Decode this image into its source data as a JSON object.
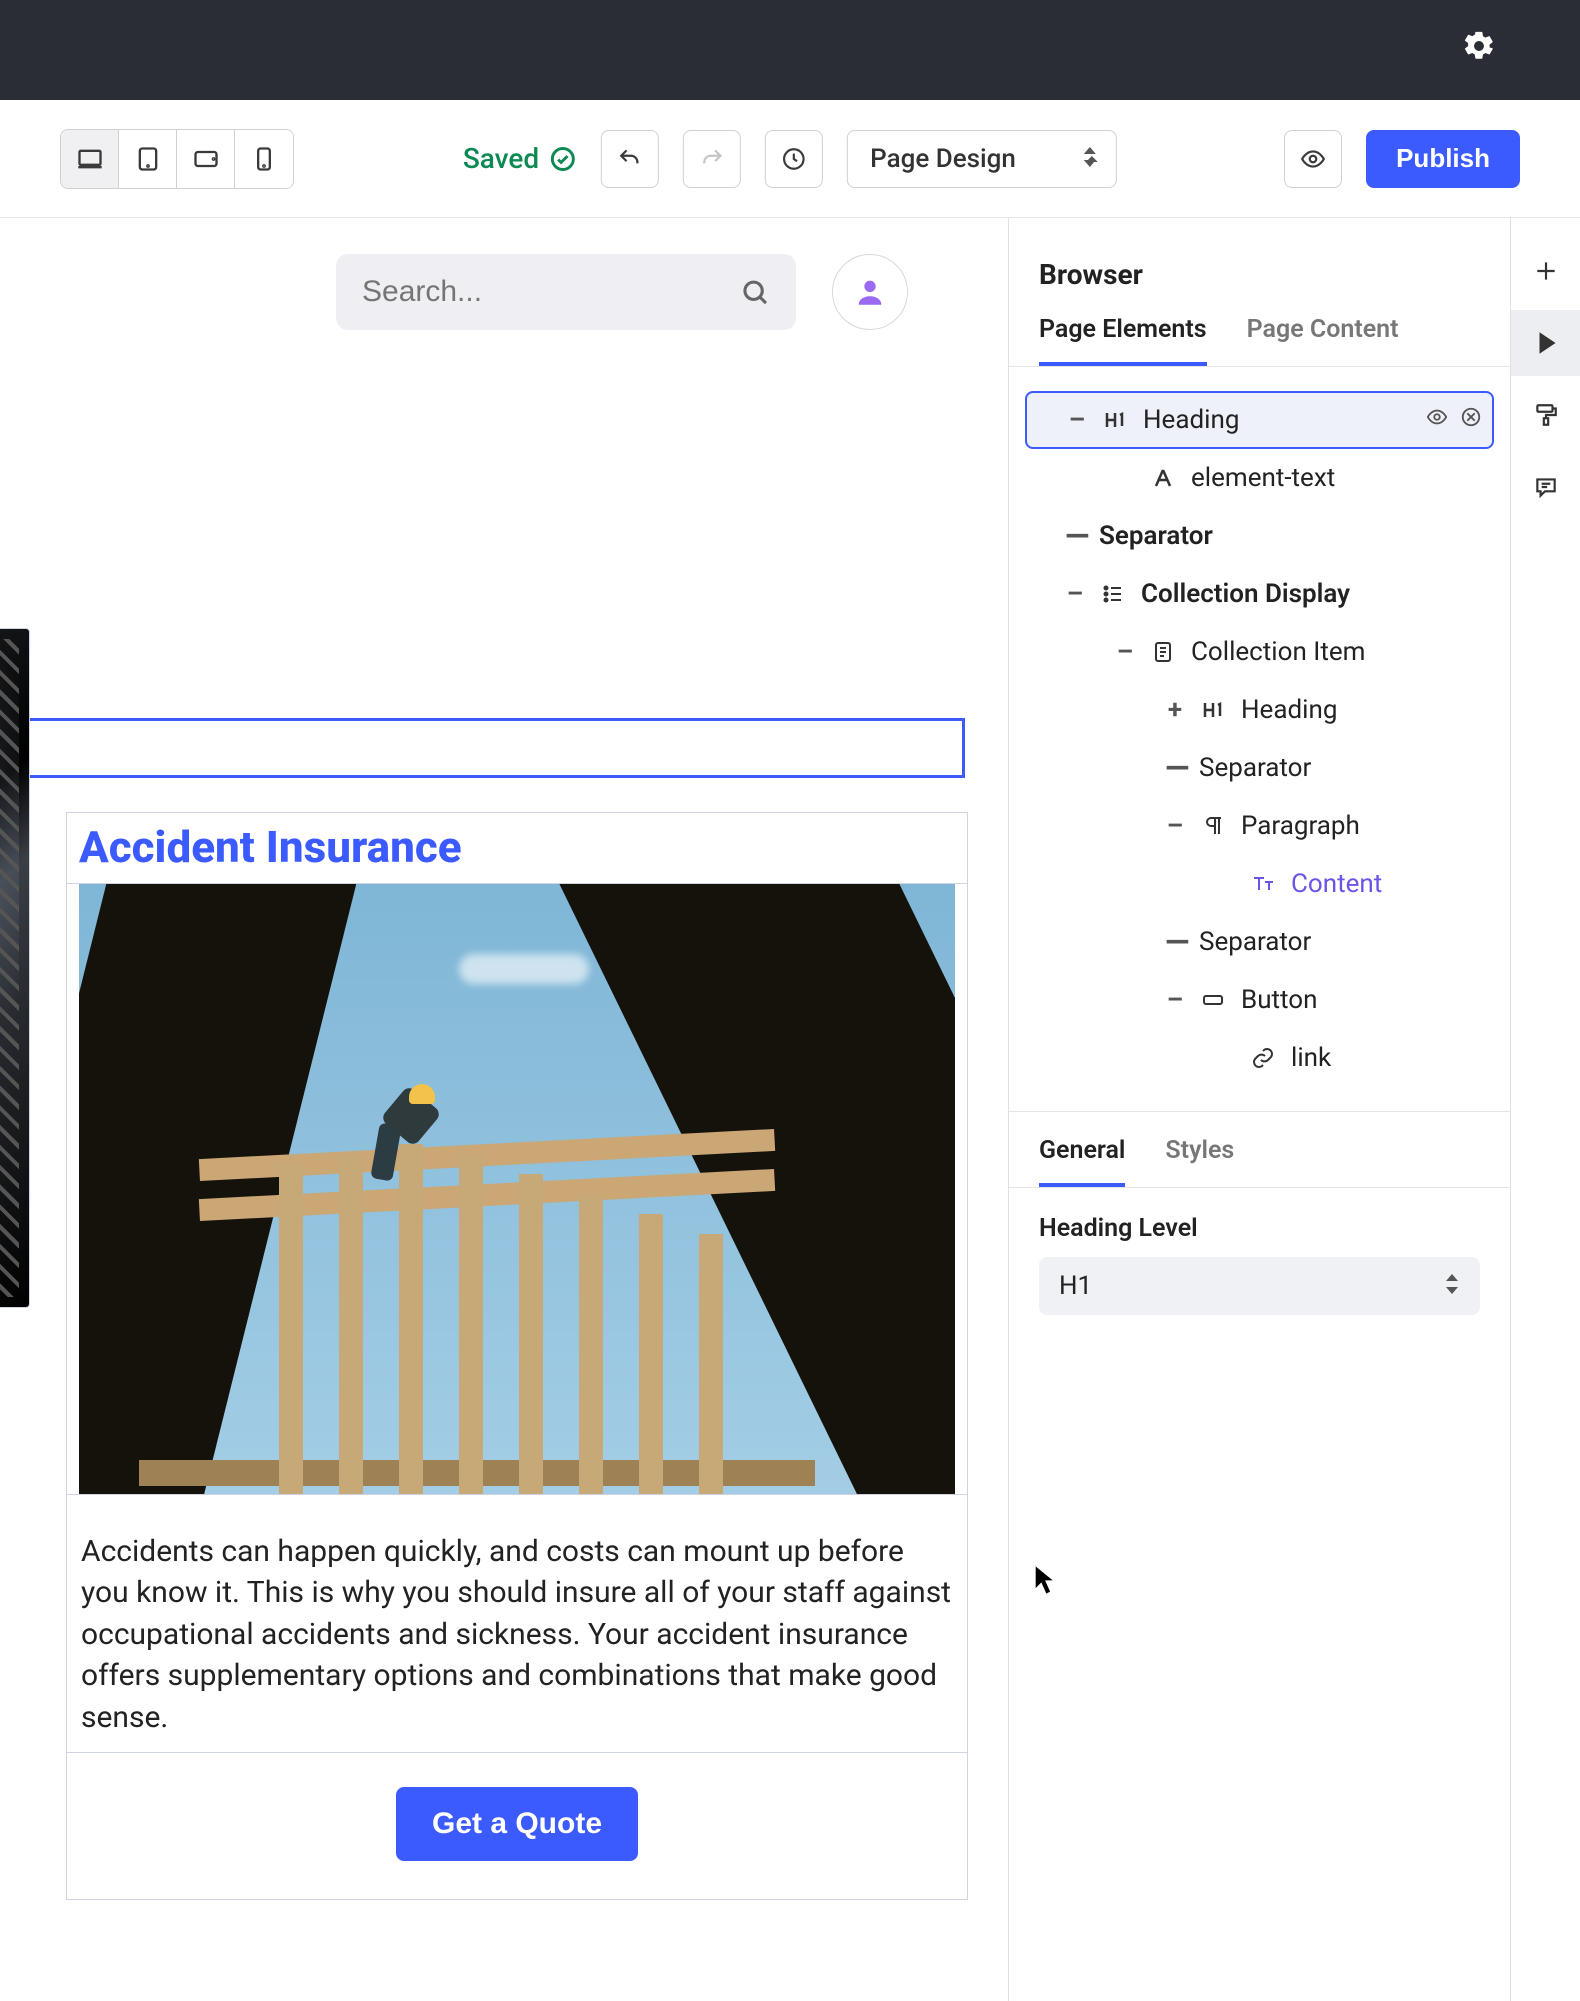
{
  "toolbar": {
    "saved_label": "Saved",
    "mode_label": "Page Design",
    "publish_label": "Publish"
  },
  "search": {
    "placeholder": "Search..."
  },
  "card": {
    "title": "Accident Insurance",
    "body": "Accidents can happen quickly, and costs can mount up before you know it. This is why you should insure all of your staff against occupational accidents and sickness. Your accident insurance offers supplementary options and combinations that make good sense.",
    "cta": "Get a Quote"
  },
  "browser": {
    "title": "Browser",
    "tabs": {
      "elements": "Page Elements",
      "content": "Page Content"
    }
  },
  "tree": {
    "heading": "Heading",
    "element_text": "element-text",
    "separator": "Separator",
    "collection_display": "Collection Display",
    "collection_item": "Collection Item",
    "paragraph": "Paragraph",
    "content": "Content",
    "button": "Button",
    "link": "link"
  },
  "props": {
    "tabs": {
      "general": "General",
      "styles": "Styles"
    },
    "heading_level_label": "Heading Level",
    "heading_level_value": "H1"
  }
}
